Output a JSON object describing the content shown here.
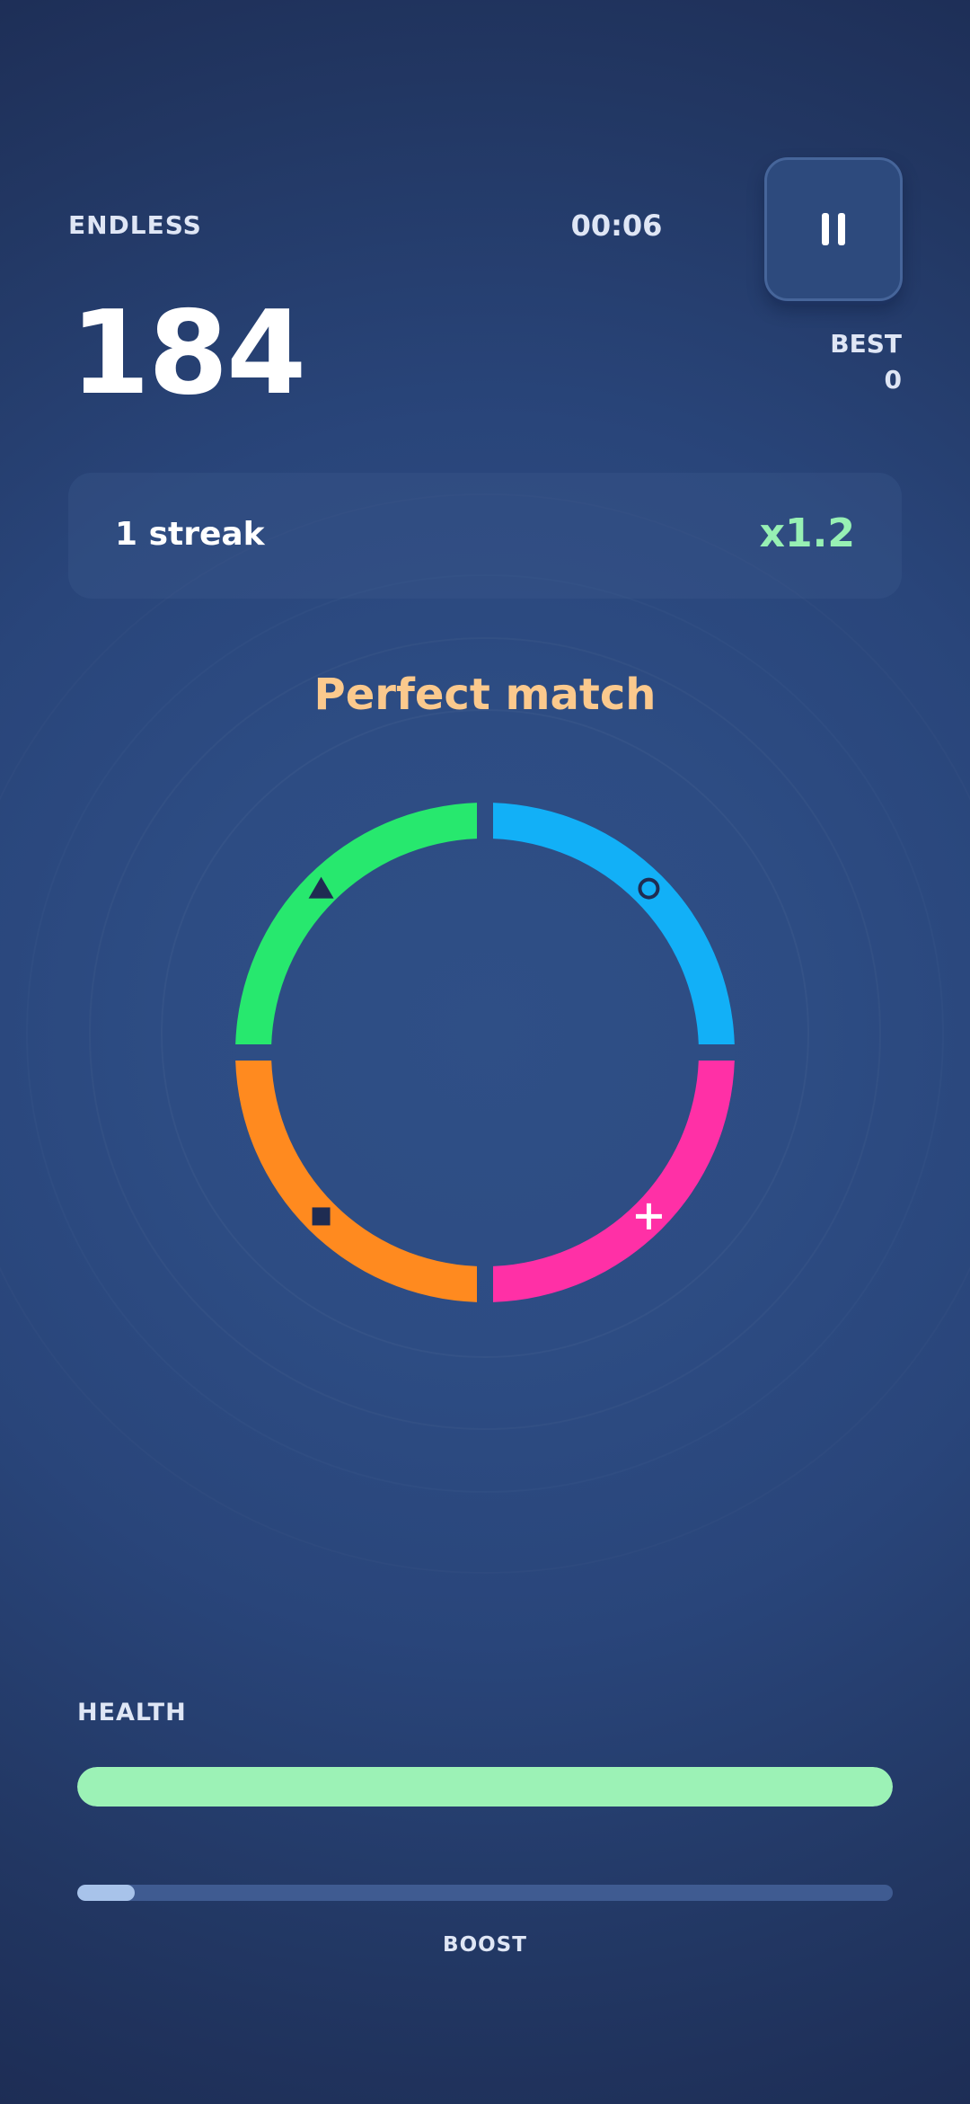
{
  "header": {
    "mode": "ENDLESS",
    "timer": "00:06",
    "pause_icon": "pause-icon"
  },
  "score": {
    "value": "184",
    "best_label": "BEST",
    "best_value": "0"
  },
  "streak": {
    "text": "1 streak",
    "multiplier": "x1.2"
  },
  "feedback": "Perfect match",
  "wheel": {
    "segments": [
      {
        "name": "top-left",
        "color": "#27e86e",
        "symbol": "triangle",
        "symbol_color": "#1f2c52"
      },
      {
        "name": "top-right",
        "color": "#12b0f7",
        "symbol": "circle",
        "symbol_color": "#1f2c52"
      },
      {
        "name": "bottom-left",
        "color": "#ff8a1f",
        "symbol": "square",
        "symbol_color": "#1f2c52"
      },
      {
        "name": "bottom-right",
        "color": "#ff30a6",
        "symbol": "plus",
        "symbol_color": "#ffffff"
      }
    ]
  },
  "health": {
    "label": "HEALTH",
    "fraction": 1.0,
    "color": "#9cf2b6"
  },
  "boost": {
    "label": "BOOST",
    "fraction": 0.07,
    "color": "#a8c3ea"
  }
}
